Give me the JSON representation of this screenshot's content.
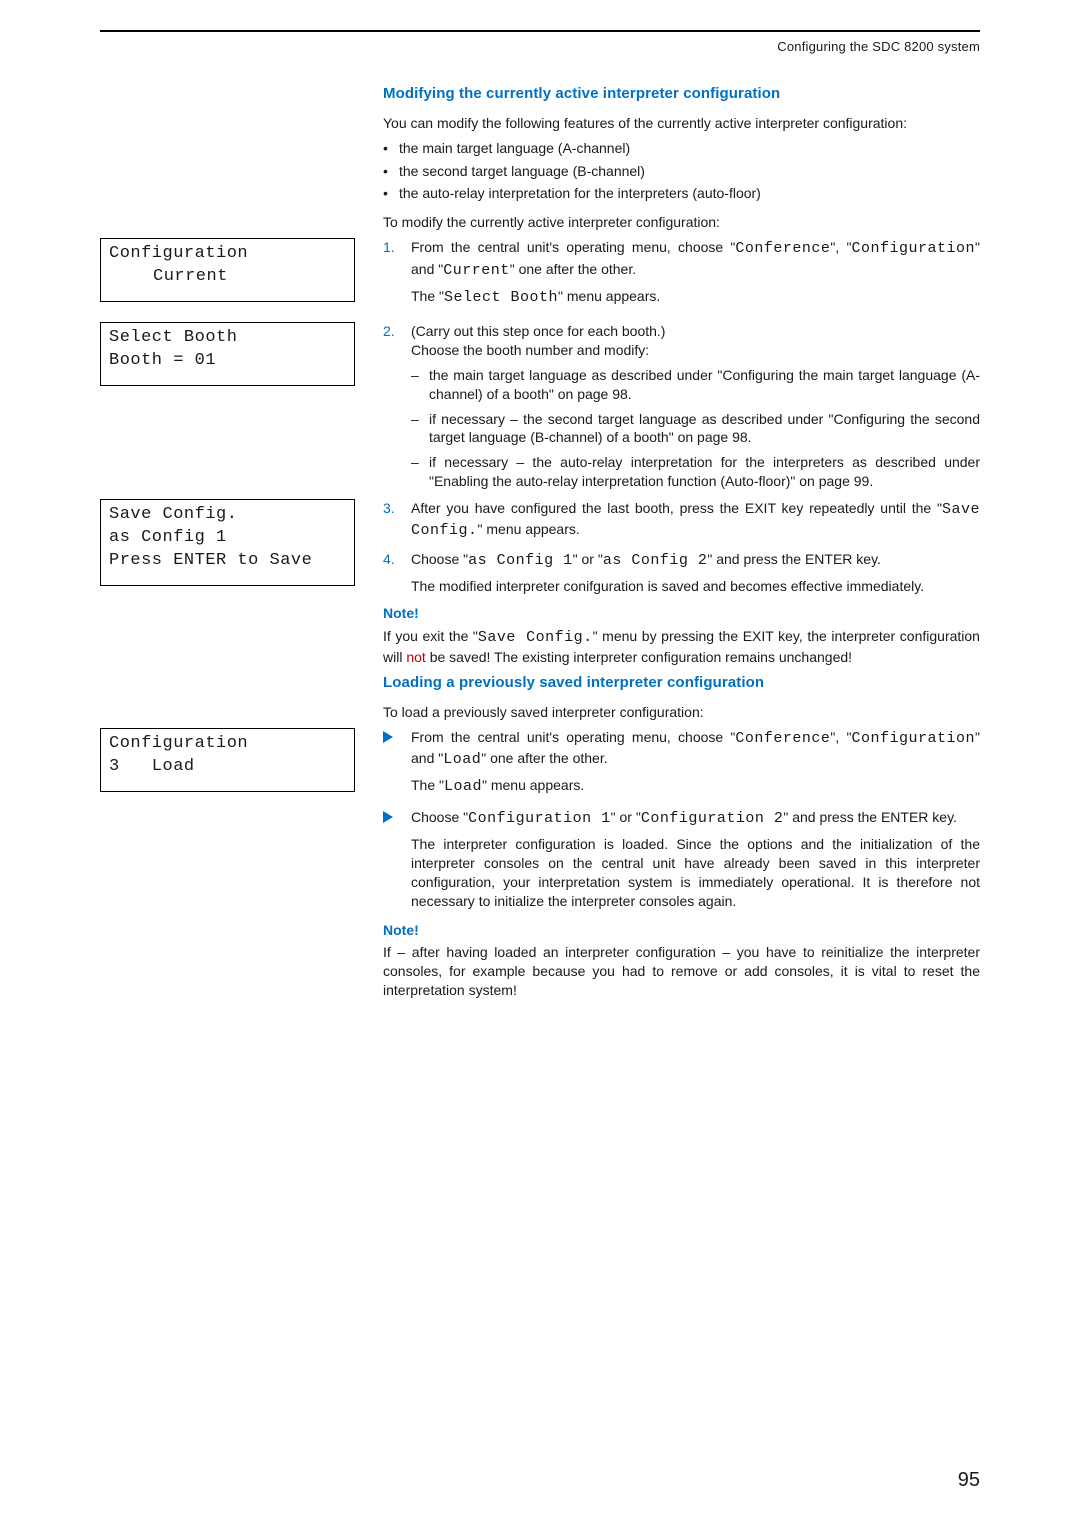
{
  "header": {
    "title": "Configuring the SDC 8200 system"
  },
  "lcd": {
    "box1": {
      "l1": "Configuration",
      "l2": "Current"
    },
    "box2": {
      "l1": "Select Booth",
      "l2": "Booth = 01"
    },
    "box3": {
      "l1": "Save Config.",
      "l2": "as Config 1",
      "l3": "Press ENTER to Save"
    },
    "box4": {
      "l1": "Configuration",
      "l2": "3   Load"
    }
  },
  "sec1": {
    "title": "Modifying the currently active interpreter configuration",
    "intro": "You can modify the following features of the currently active interpreter configuration:",
    "bullets": [
      "the main target language (A-channel)",
      "the second target language (B-channel)",
      "the auto-relay interpretation for the interpreters (auto-floor)"
    ],
    "lead": "To modify the currently active interpreter configuration:",
    "s1a": "From the central unit's operating menu, choose \"",
    "s1m1": "Conference",
    "s1b": "\", \"",
    "s1m2": "Configuration",
    "s1c": "\" and \"",
    "s1m3": "Current",
    "s1d": "\" one after the other.",
    "s1e": "The \"",
    "s1m4": "Select Booth",
    "s1f": "\" menu appears.",
    "s2a": "(Carry out this step once for each booth.)",
    "s2b": "Choose the booth number and modify:",
    "s2d1": "the main target language as described under \"Configuring the main target language (A-channel) of a booth\" on page 98.",
    "s2d2": "if necessary – the second target language as described under \"Configuring the second target language (B-channel) of a booth\" on page 98.",
    "s2d3": "if necessary – the auto-relay interpretation for the interpreters as described under \"Enabling the auto-relay interpretation function (Auto-floor)\" on page 99.",
    "s3a": "After you have configured the last booth, press the EXIT key repeatedly until the \"",
    "s3m1": "Save Config.",
    "s3b": "\" menu appears.",
    "s4a": "Choose \"",
    "s4m1": "as Config 1",
    "s4b": "\" or \"",
    "s4m2": "as Config 2",
    "s4c": "\" and press the ENTER key.",
    "s4d": "The modified interpreter conifguration is saved and becomes effective immediately.",
    "note_head": "Note!",
    "note_a": "If you exit the \"",
    "note_m1": "Save Config.",
    "note_b": "\" menu by pressing the EXIT key, the interpreter configuration will ",
    "note_not": "not",
    "note_c": " be saved! The existing interpreter configuration remains unchanged!"
  },
  "sec2": {
    "title": "Loading a previously saved interpreter configuration",
    "lead": "To load a previously saved interpreter configuration:",
    "t1a": "From the central unit's operating menu, choose \"",
    "t1m1": "Conference",
    "t1b": "\", \"",
    "t1m2": "Configuration",
    "t1c": "\" and \"",
    "t1m3": "Load",
    "t1d": "\" one after the other.",
    "t1e": "The \"",
    "t1m4": "Load",
    "t1f": "\" menu appears.",
    "t2a": "Choose \"",
    "t2m1": "Configuration 1",
    "t2b": "\" or \"",
    "t2m2": "Configuration 2",
    "t2c": "\" and press the ENTER key.",
    "t2d": "The interpreter configuration is loaded. Since the options and the initialization of the interpreter consoles on the central unit have already been saved in this interpreter configuration, your interpretation system is immediately operational. It is therefore not necessary to initialize the interpreter consoles again.",
    "note_head": "Note!",
    "note_body": "If – after having loaded an interpreter configuration – you have to reinitialize the interpreter consoles, for example because you had to remove or add consoles, it is vital to reset the interpretation system!"
  },
  "page": "95"
}
